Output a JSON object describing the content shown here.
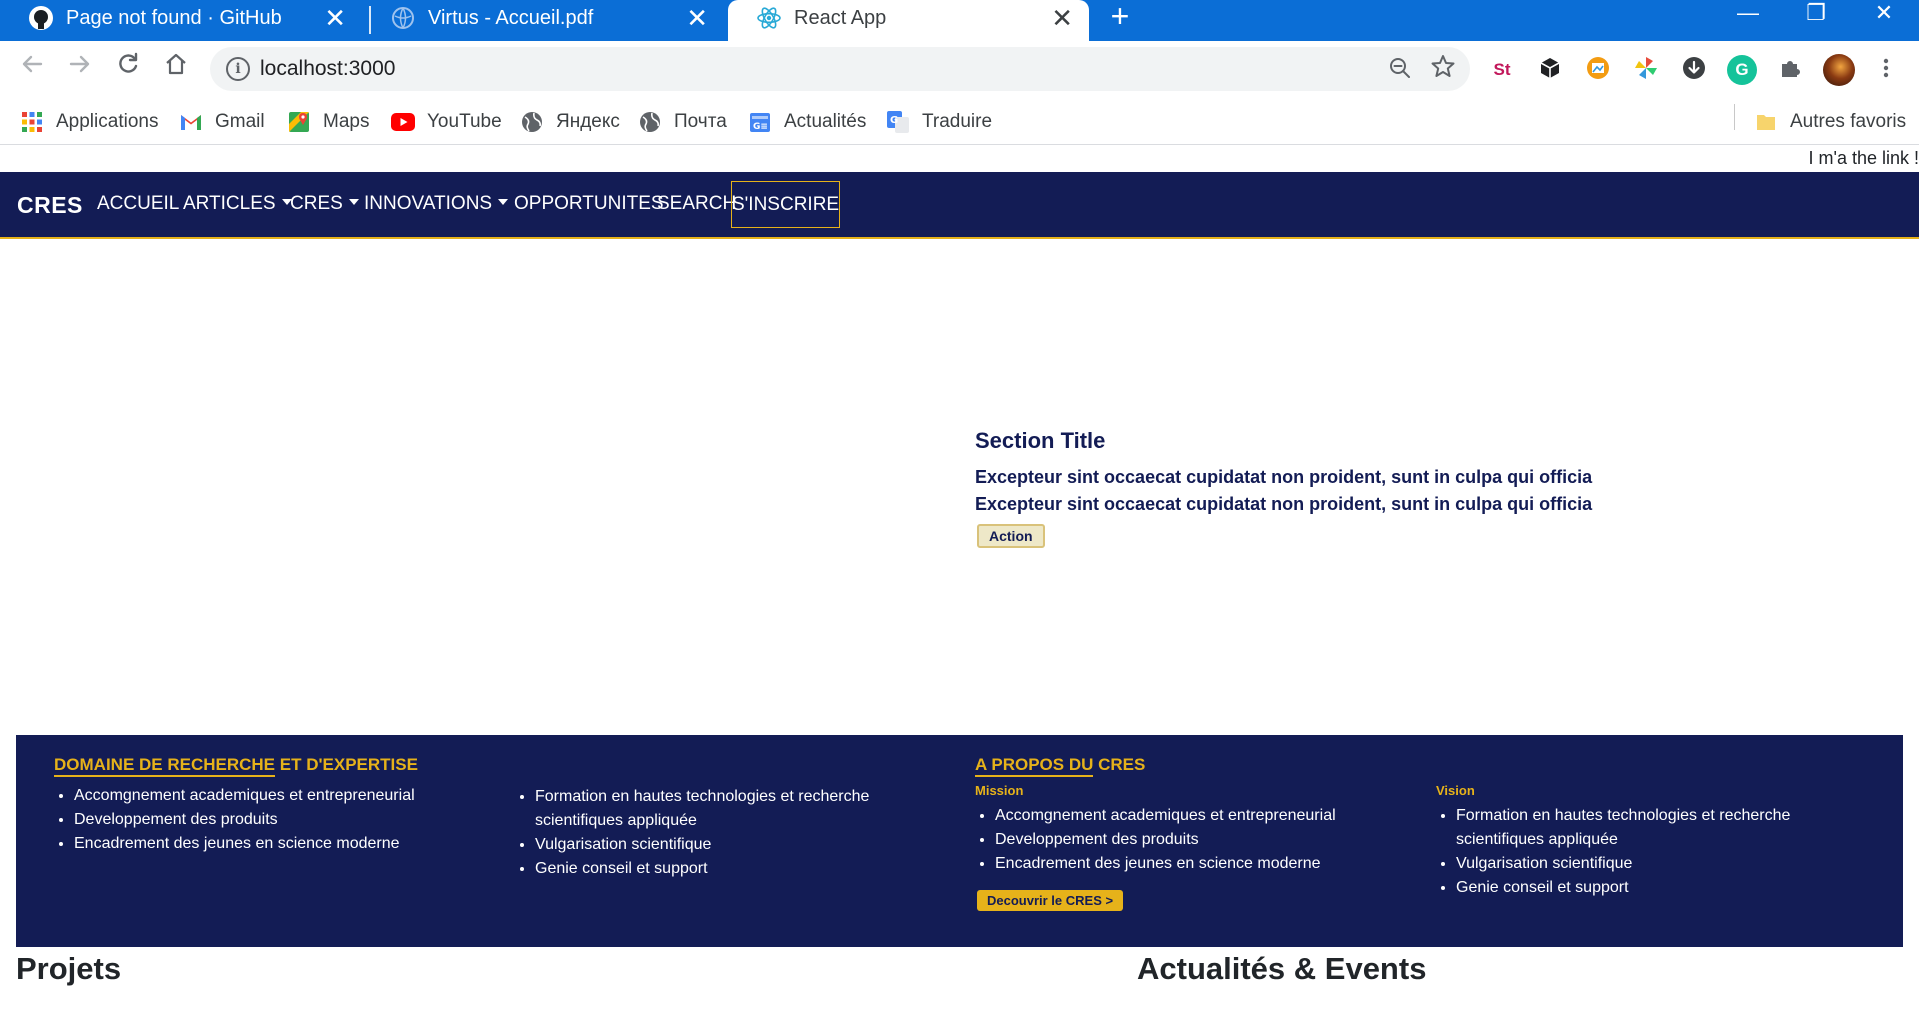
{
  "browser": {
    "tabs": [
      {
        "title": "Page not found · GitHub",
        "icon": "github-icon",
        "active": false
      },
      {
        "title": "Virtus - Accueil.pdf",
        "icon": "globe-icon",
        "active": false
      },
      {
        "title": "React App",
        "icon": "react-icon",
        "active": true
      }
    ],
    "close_glyph": "✕",
    "new_tab_glyph": "+",
    "window_controls": {
      "minimize": "—",
      "restore": "❐",
      "close": "✕"
    },
    "address": "localhost:3000",
    "bookmarks": [
      {
        "label": "Applications",
        "icon": "apps-grid-icon"
      },
      {
        "label": "Gmail",
        "icon": "gmail-icon"
      },
      {
        "label": "Maps",
        "icon": "maps-icon"
      },
      {
        "label": "YouTube",
        "icon": "youtube-icon"
      },
      {
        "label": "Яндекс",
        "icon": "globe-icon"
      },
      {
        "label": "Почта",
        "icon": "globe-icon"
      },
      {
        "label": "Actualités",
        "icon": "news-icon"
      },
      {
        "label": "Traduire",
        "icon": "translate-icon"
      }
    ],
    "other_bookmarks": "Autres favoris",
    "accent": "#0b6ed6"
  },
  "page": {
    "top_link": "I m'a the link !",
    "nav": {
      "brand": "CRES",
      "links": [
        "ACCUEIL",
        "ARTICLES",
        "CRES",
        "INNOVATIONS",
        "OPPORTUNITES",
        "SEARCH"
      ],
      "signup": "S'INSCRIRE"
    },
    "hero": {
      "title": "Section Title",
      "line1": "Excepteur sint occaecat cupidatat non proident, sunt in culpa qui officia",
      "line2": "Excepteur sint occaecat cupidatat non proident, sunt in culpa qui officia",
      "action": "Action"
    },
    "footer": {
      "domain_heading_u": "DOMAINE DE RECHERCHE",
      "domain_heading_rest": " ET D'EXPERTISE",
      "domain_left": [
        "Accomgnement academiques et entrepreneurial",
        "Developpement des produits",
        "Encadrement des jeunes en science moderne"
      ],
      "domain_right": [
        "Formation en hautes technologies et recherche scientifiques appliquée",
        "Vulgarisation scientifique",
        "Genie conseil et support"
      ],
      "about_heading_u": "A PROPOS DU",
      "about_heading_rest": " CRES",
      "mission_label": "Mission",
      "mission": [
        "Accomgnement academiques et entrepreneurial",
        "Developpement des produits",
        "Encadrement des jeunes en science moderne"
      ],
      "vision_label": "Vision",
      "vision": [
        "Formation en hautes technologies et recherche scientifiques appliquée",
        "Vulgarisation scientifique",
        "Genie conseil et support"
      ],
      "cta": "Decouvrir le CRES >"
    },
    "sections": {
      "projects": "Projets",
      "news": "Actualités & Events"
    },
    "colors": {
      "navy": "#131c55",
      "gold": "#e6b21a"
    }
  }
}
